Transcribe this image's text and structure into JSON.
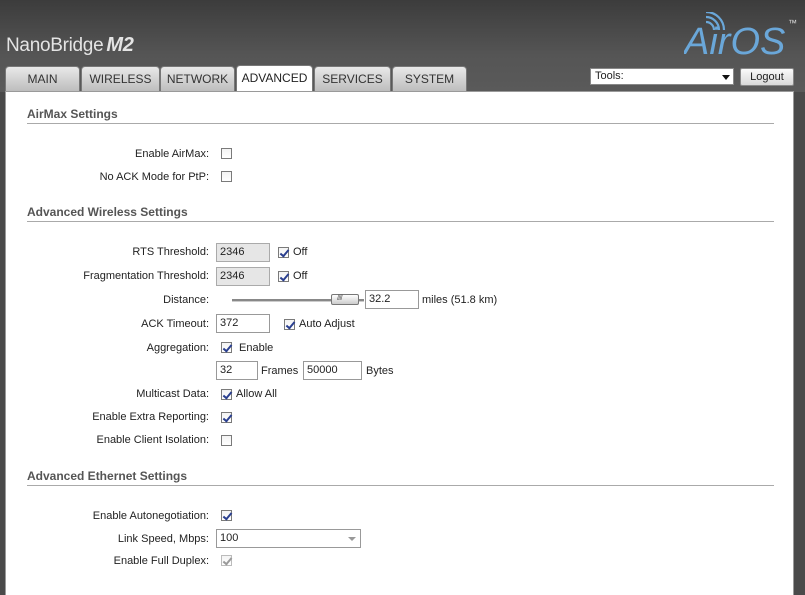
{
  "header": {
    "brand": "NanoBridge",
    "brand_sub": "M2",
    "logo_text": "AirOS",
    "logo_tm": "™"
  },
  "tabs": [
    {
      "label": "MAIN"
    },
    {
      "label": "WIRELESS"
    },
    {
      "label": "NETWORK"
    },
    {
      "label": "ADVANCED",
      "active": true
    },
    {
      "label": "SERVICES"
    },
    {
      "label": "SYSTEM"
    }
  ],
  "toolbar": {
    "tools_selected": "Tools:",
    "logout_label": "Logout"
  },
  "airmax": {
    "title": "AirMax Settings",
    "enable_label": "Enable AirMax:",
    "enable_checked": false,
    "noack_label": "No ACK Mode for PtP:",
    "noack_checked": false
  },
  "wireless": {
    "title": "Advanced Wireless Settings",
    "rts_label": "RTS Threshold:",
    "rts_value": "2346",
    "rts_off_label": "Off",
    "frag_label": "Fragmentation Threshold:",
    "frag_value": "2346",
    "frag_off_label": "Off",
    "distance_label": "Distance:",
    "distance_value": "32.2",
    "distance_unit": "miles (51.8 km)",
    "ack_label": "ACK Timeout:",
    "ack_value": "372",
    "ack_auto_label": "Auto Adjust",
    "aggregation_label": "Aggregation:",
    "aggregation_enable_label": "Enable",
    "frames_value": "32",
    "frames_label": "Frames",
    "bytes_value": "50000",
    "bytes_label": "Bytes",
    "multicast_label": "Multicast Data:",
    "multicast_allow_label": "Allow All",
    "extra_reporting_label": "Enable Extra Reporting:",
    "client_isolation_label": "Enable Client Isolation:"
  },
  "ethernet": {
    "title": "Advanced Ethernet Settings",
    "autoneg_label": "Enable Autonegotiation:",
    "link_speed_label": "Link Speed, Mbps:",
    "link_speed_value": "100",
    "full_duplex_label": "Enable Full Duplex:"
  },
  "colors": {
    "logo_blue": "#6aa7d9",
    "header_bg": "#4a4a4a",
    "check_mark": "#2a3f8f"
  }
}
